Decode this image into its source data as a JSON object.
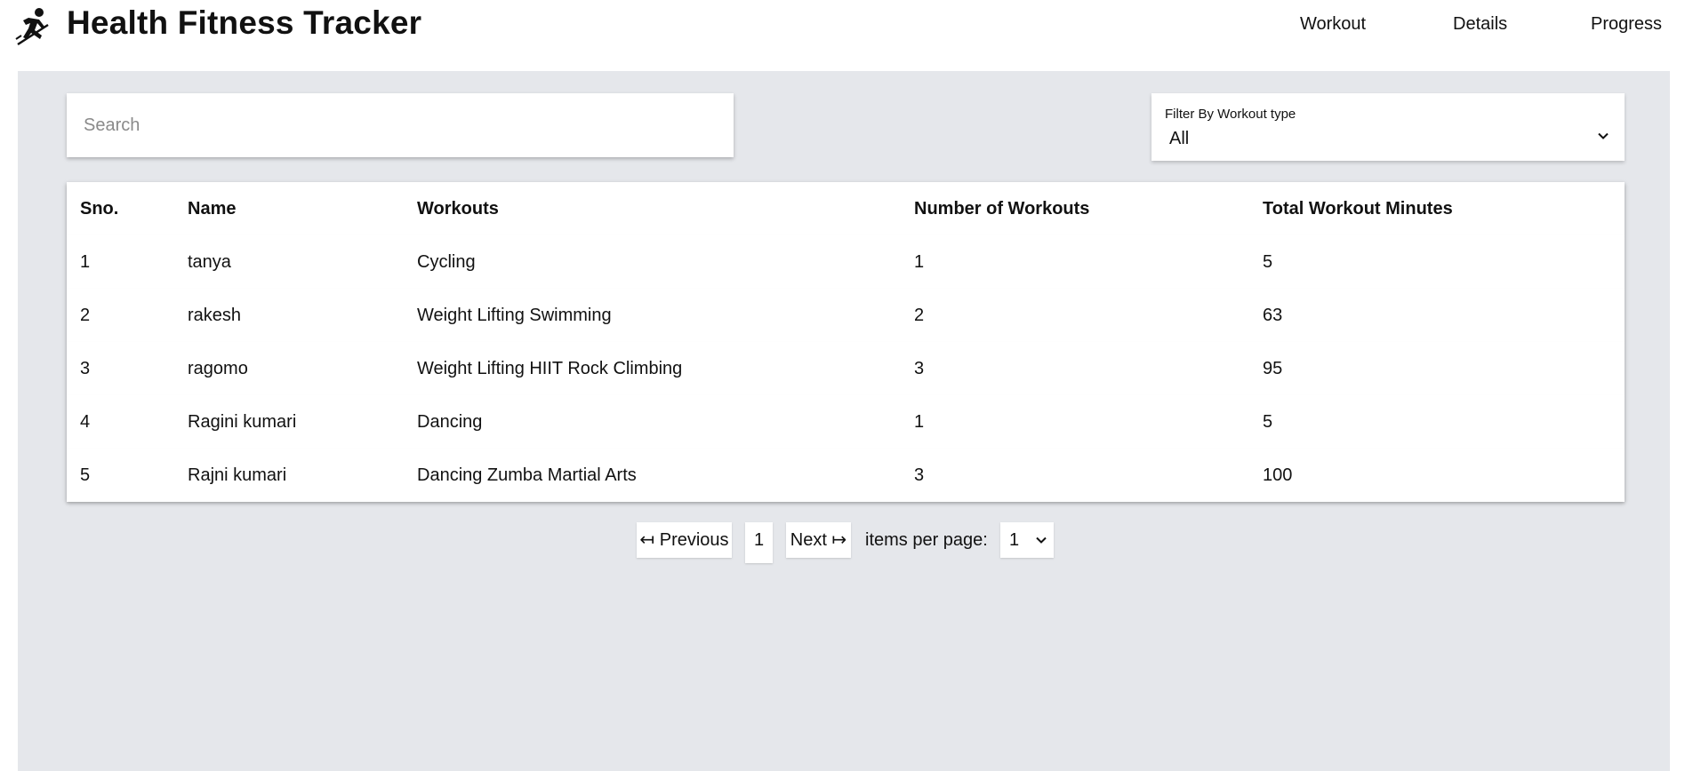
{
  "header": {
    "title": "Health Fitness Tracker",
    "logo_icon": "runner-icon",
    "nav": [
      "Workout",
      "Details",
      "Progress"
    ]
  },
  "search": {
    "placeholder": "Search",
    "value": ""
  },
  "filter": {
    "label": "Filter By Workout type",
    "value": "All"
  },
  "table": {
    "columns": [
      "Sno.",
      "Name",
      "Workouts",
      "Number of Workouts",
      "Total Workout Minutes"
    ],
    "rows": [
      [
        "1",
        "tanya",
        "Cycling",
        "1",
        "5"
      ],
      [
        "2",
        "rakesh",
        "Weight Lifting Swimming",
        "2",
        "63"
      ],
      [
        "3",
        "ragomo",
        "Weight Lifting HIIT Rock Climbing",
        "3",
        "95"
      ],
      [
        "4",
        "Ragini kumari",
        "Dancing",
        "1",
        "5"
      ],
      [
        "5",
        "Rajni kumari",
        "Dancing Zumba Martial Arts",
        "3",
        "100"
      ]
    ]
  },
  "pagination": {
    "previous_label": "↤ Previous",
    "current_page": "1",
    "next_label": "Next ↦",
    "items_per_page_label": "items per page:",
    "items_per_page_value": "1"
  },
  "colors": {
    "page_background": "#e5e7eb",
    "card_background": "#ffffff",
    "text": "#111111"
  }
}
